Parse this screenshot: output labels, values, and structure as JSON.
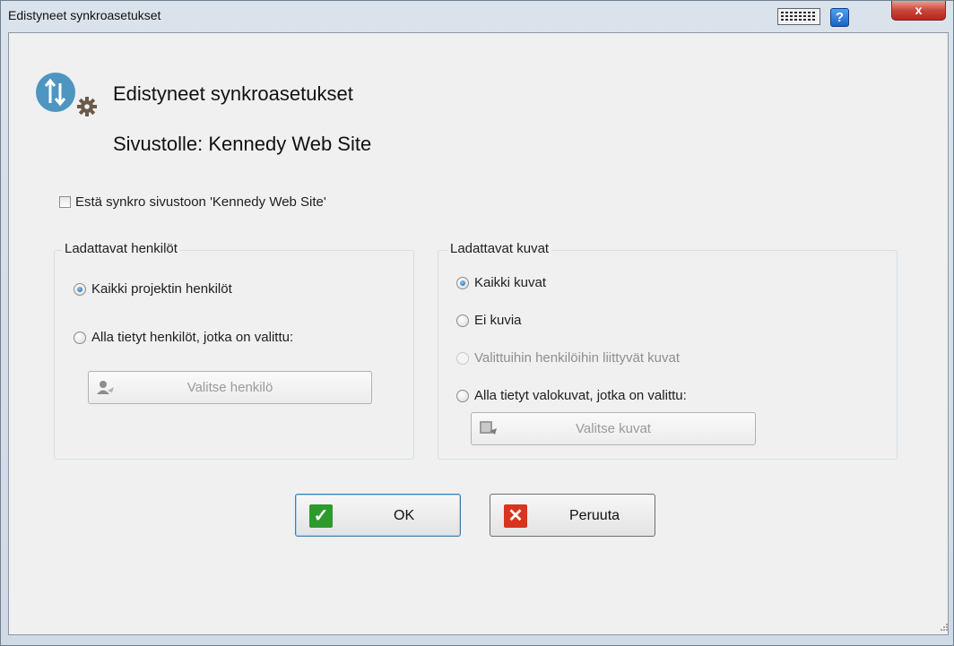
{
  "window": {
    "title": "Edistyneet synkroasetukset",
    "close_label": "x",
    "help_label": "?"
  },
  "header": {
    "title": "Edistyneet synkroasetukset",
    "subtitle": "Sivustolle: Kennedy Web Site"
  },
  "block_sync": {
    "label": "Estä synkro sivustoon 'Kennedy Web Site'",
    "checked": false
  },
  "persons_group": {
    "title": "Ladattavat henkilöt",
    "options": [
      {
        "label": "Kaikki projektin henkilöt",
        "checked": true
      },
      {
        "label": "Alla tietyt henkilöt, jotka on valittu:",
        "checked": false
      }
    ],
    "select_button": "Valitse henkilö"
  },
  "pictures_group": {
    "title": "Ladattavat kuvat",
    "options": [
      {
        "label": "Kaikki kuvat",
        "checked": true,
        "enabled": true
      },
      {
        "label": "Ei kuvia",
        "checked": false,
        "enabled": true
      },
      {
        "label": "Valittuihin henkilöihin liittyvät kuvat",
        "checked": false,
        "enabled": false
      },
      {
        "label": "Alla tietyt valokuvat, jotka on valittu:",
        "checked": false,
        "enabled": true
      }
    ],
    "select_button": "Valitse kuvat"
  },
  "buttons": {
    "ok": "OK",
    "cancel": "Peruuta"
  },
  "colors": {
    "ok_accent": "#2e9a2e",
    "cancel_accent": "#d8341e",
    "icon_blue": "#4f95c1"
  }
}
